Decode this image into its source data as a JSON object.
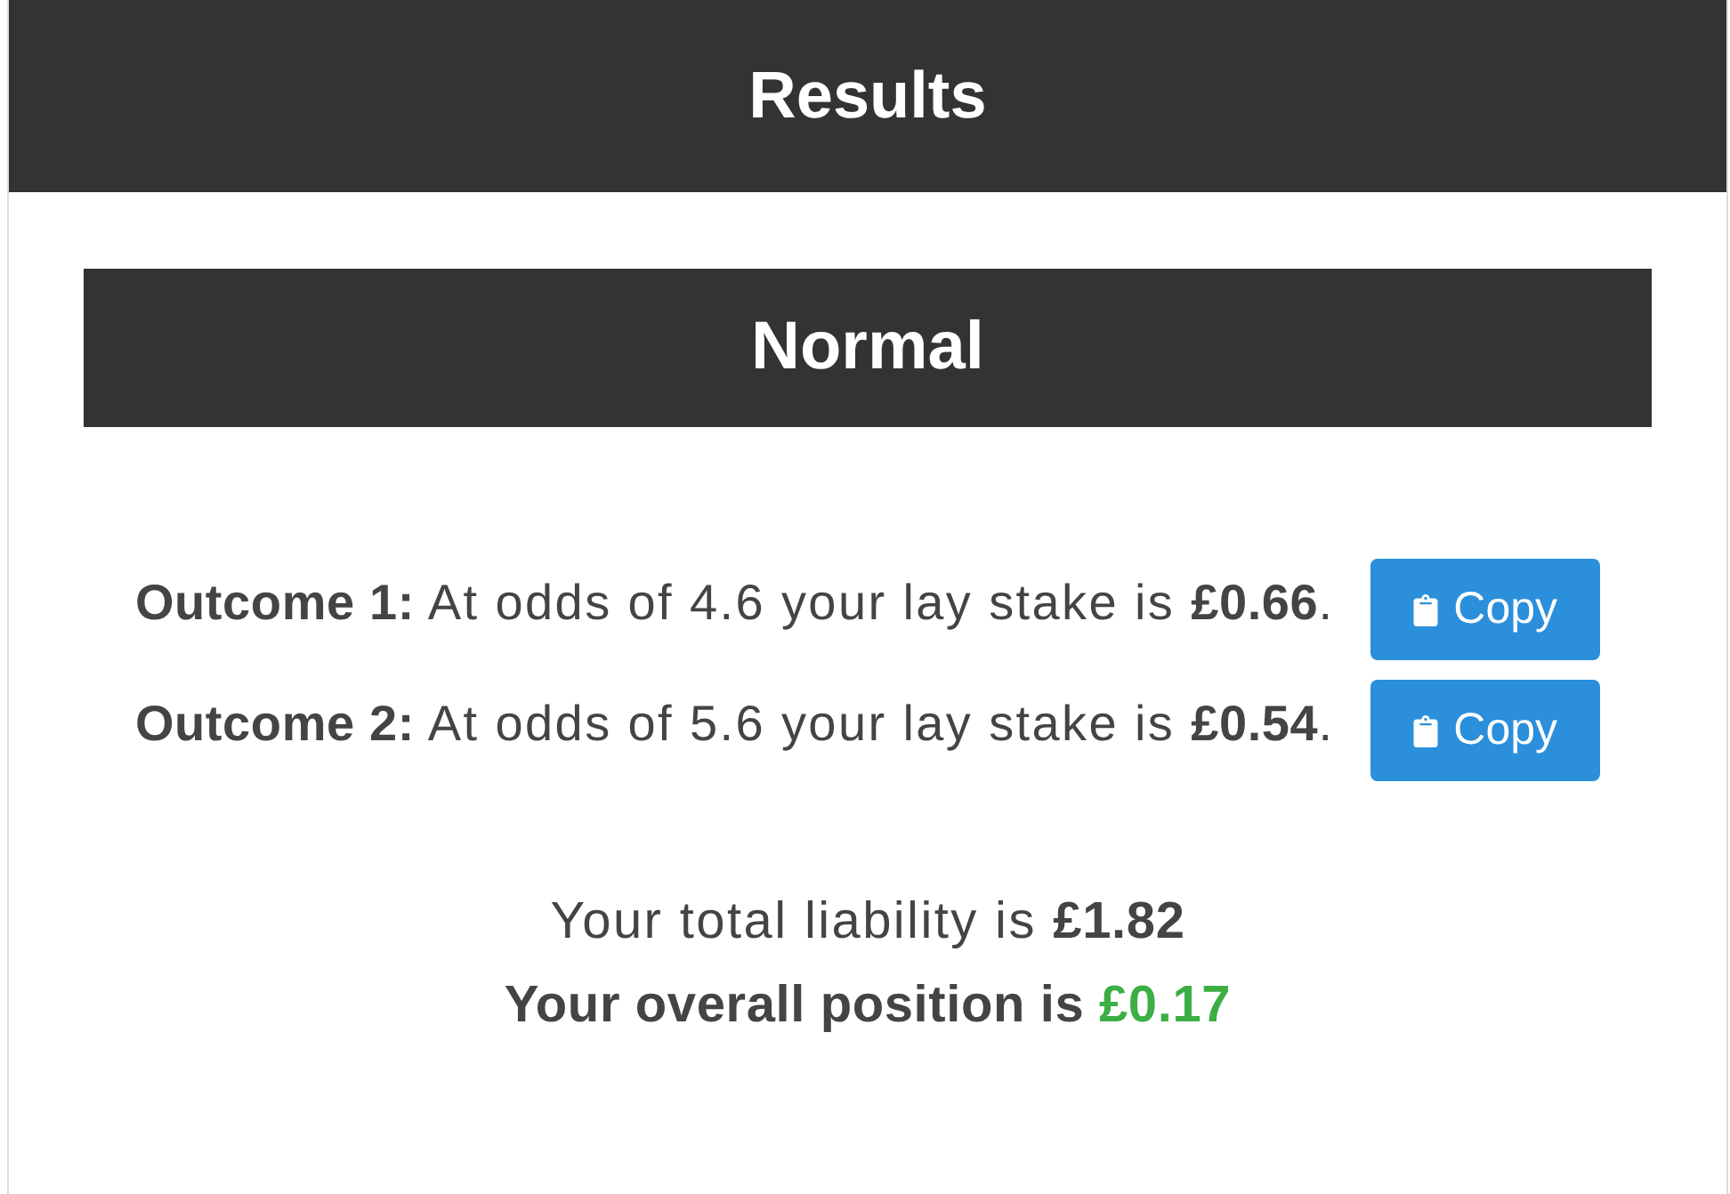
{
  "header": {
    "title": "Results"
  },
  "section": {
    "title": "Normal"
  },
  "outcomes": [
    {
      "text": "**Outcome 1:** At odds of 4.6 your lay stake is **£0.66**.",
      "button": "Copy"
    },
    {
      "text": "**Outcome 2:** At odds of 5.6 your lay stake is **£0.54**.",
      "button": "Copy"
    }
  ],
  "summary": {
    "liability": "Your total liability is **£1.82**",
    "position": {
      "label": "Your overall position is",
      "amount": "£0.17",
      "positive": true
    }
  }
}
